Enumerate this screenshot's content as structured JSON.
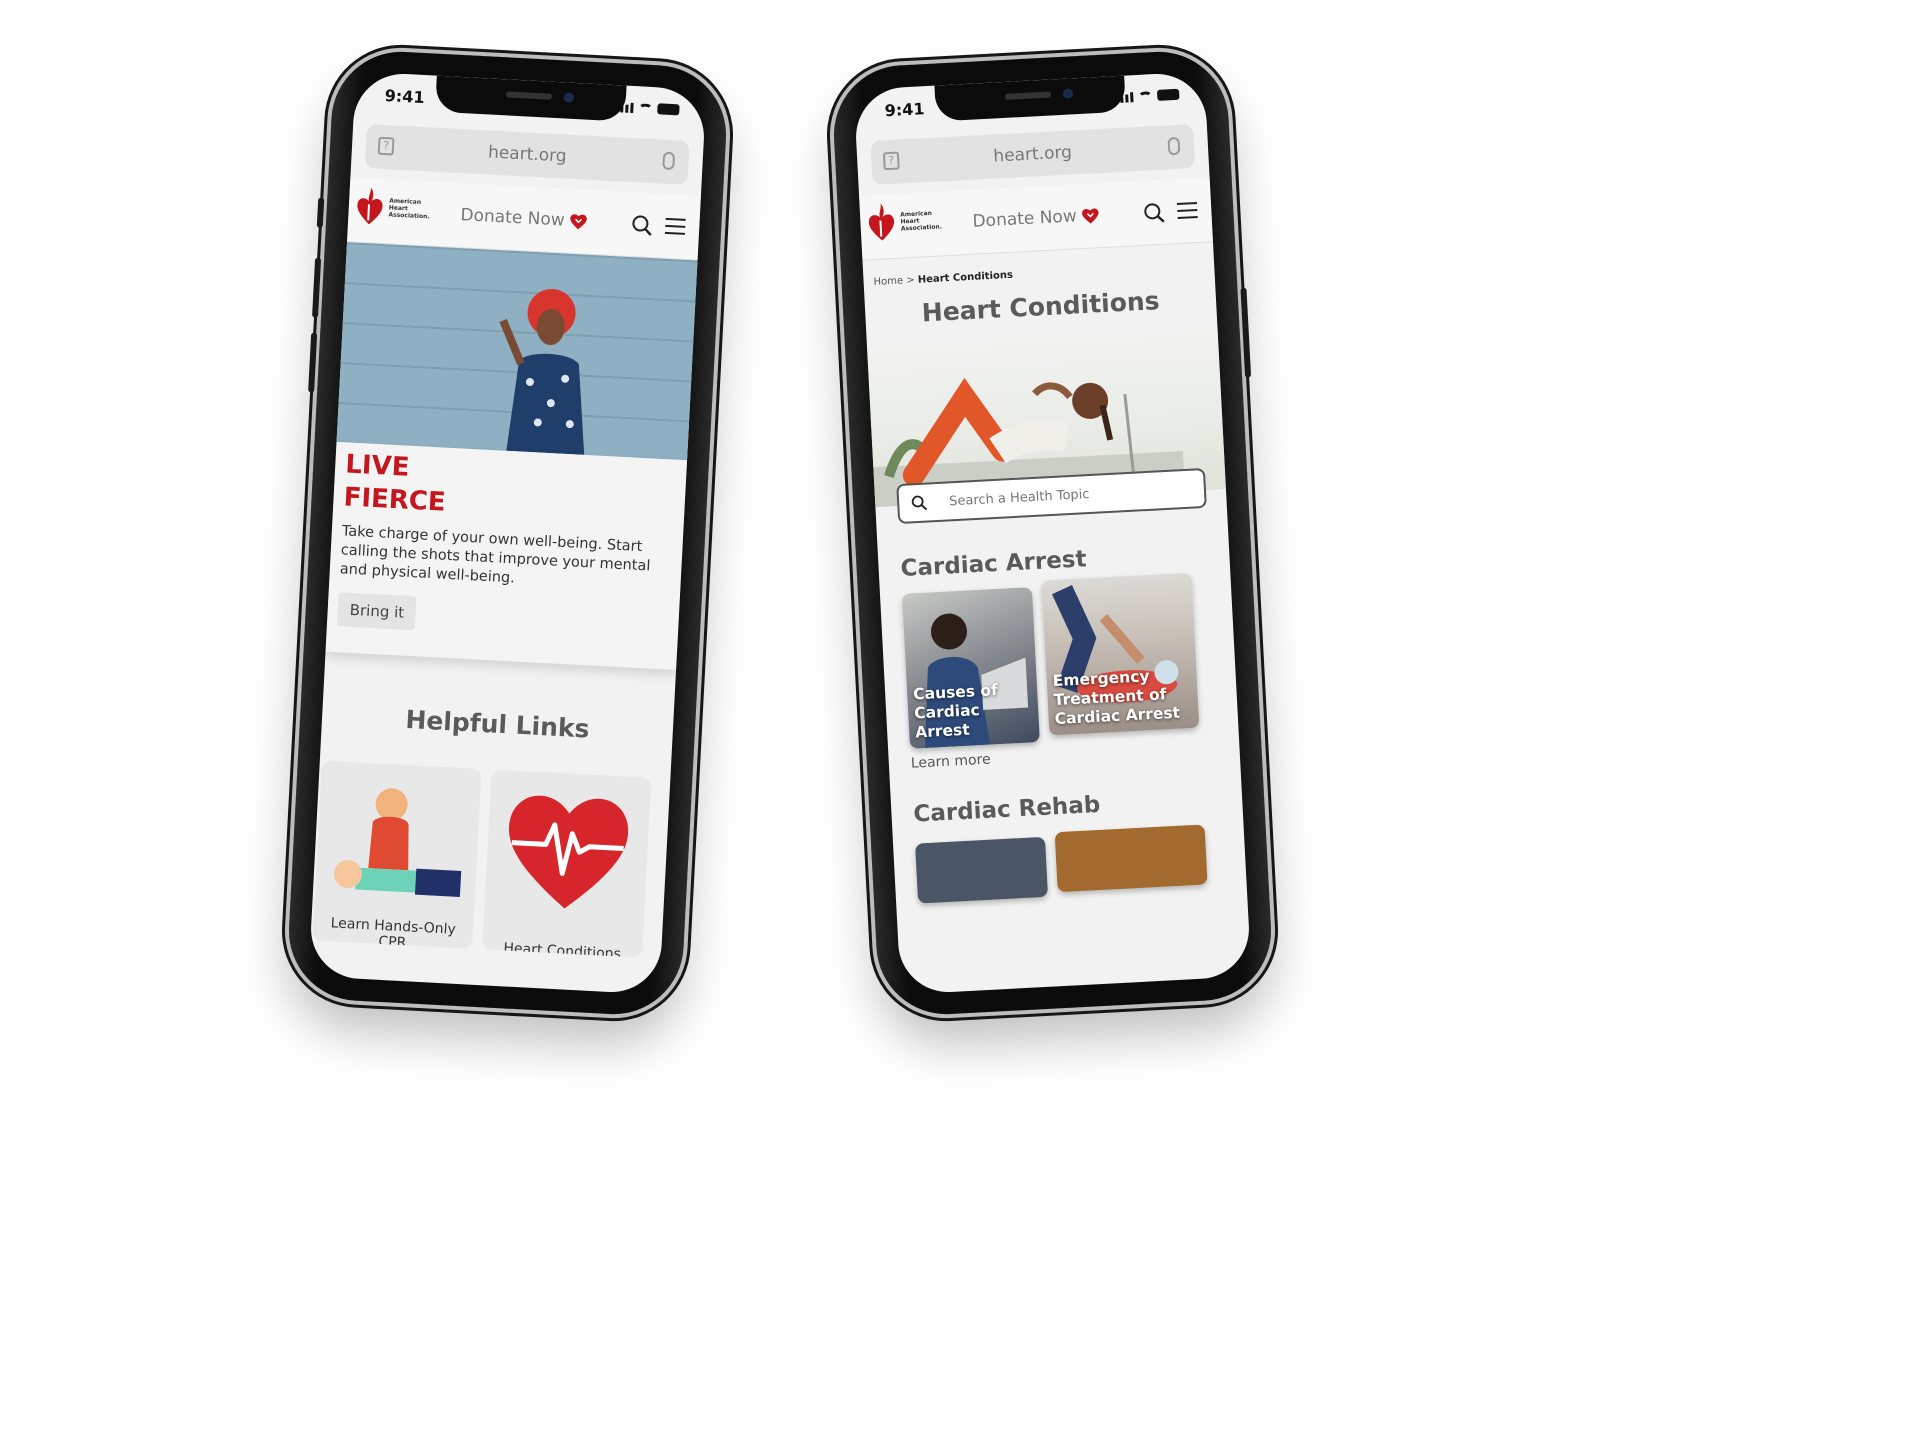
{
  "colors": {
    "brand_red": "#c4161c",
    "text_gray": "#5a5a5a"
  },
  "left_phone": {
    "status": {
      "time": "9:41"
    },
    "browser": {
      "url": "heart.org"
    },
    "header": {
      "logo_text": "American Heart Association.",
      "donate_label": "Donate Now"
    },
    "hero": {
      "title_line1": "LIVE",
      "title_line2": "FIERCE",
      "body": "Take charge of your own well-being. Start calling the shots that improve your mental and physical well-being.",
      "button_label": "Bring it"
    },
    "helpful_links": {
      "title": "Helpful Links",
      "cards": [
        {
          "caption": "Learn Hands-Only CPR",
          "icon": "cpr-illustration-icon"
        },
        {
          "caption": "Heart Conditions",
          "icon": "heartbeat-heart-icon"
        }
      ]
    }
  },
  "right_phone": {
    "status": {
      "time": "9:41"
    },
    "browser": {
      "url": "heart.org"
    },
    "header": {
      "logo_text": "American Heart Association.",
      "donate_label": "Donate Now"
    },
    "breadcrumb": {
      "home": "Home",
      "separator": ">",
      "current": "Heart Conditions"
    },
    "page_title": "Heart Conditions",
    "search": {
      "placeholder": "Search a Health Topic"
    },
    "sections": [
      {
        "title": "Cardiac Arrest",
        "tiles": [
          {
            "label": "Causes of Cardiac Arrest"
          },
          {
            "label": "Emergency Treatment of Cardiac Arrest"
          }
        ],
        "learn_more": "Learn more"
      },
      {
        "title": "Cardiac Rehab"
      }
    ]
  }
}
